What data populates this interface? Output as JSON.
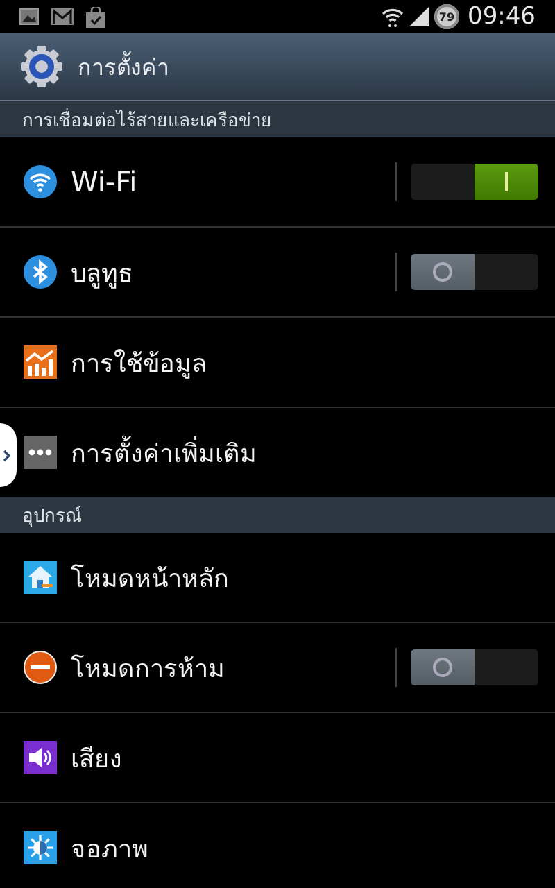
{
  "status_bar": {
    "battery": "79",
    "time": "09:46"
  },
  "title_bar": {
    "title": "การตั้งค่า"
  },
  "sections": [
    {
      "header": "การเชื่อมต่อไร้สายและเครือข่าย",
      "items": [
        {
          "label": "Wi-Fi",
          "kind": "toggle",
          "on": true
        },
        {
          "label": "บลูทูธ",
          "kind": "toggle",
          "on": false
        },
        {
          "label": "การใช้ข้อมูล",
          "kind": "plain"
        },
        {
          "label": "การตั้งค่าเพิ่มเติม",
          "kind": "plain"
        }
      ]
    },
    {
      "header": "อุปกรณ์",
      "items": [
        {
          "label": "โหมดหน้าหลัก",
          "kind": "plain"
        },
        {
          "label": "โหมดการห้าม",
          "kind": "toggle",
          "on": false
        },
        {
          "label": "เสียง",
          "kind": "plain"
        },
        {
          "label": "จอภาพ",
          "kind": "plain"
        }
      ]
    }
  ]
}
